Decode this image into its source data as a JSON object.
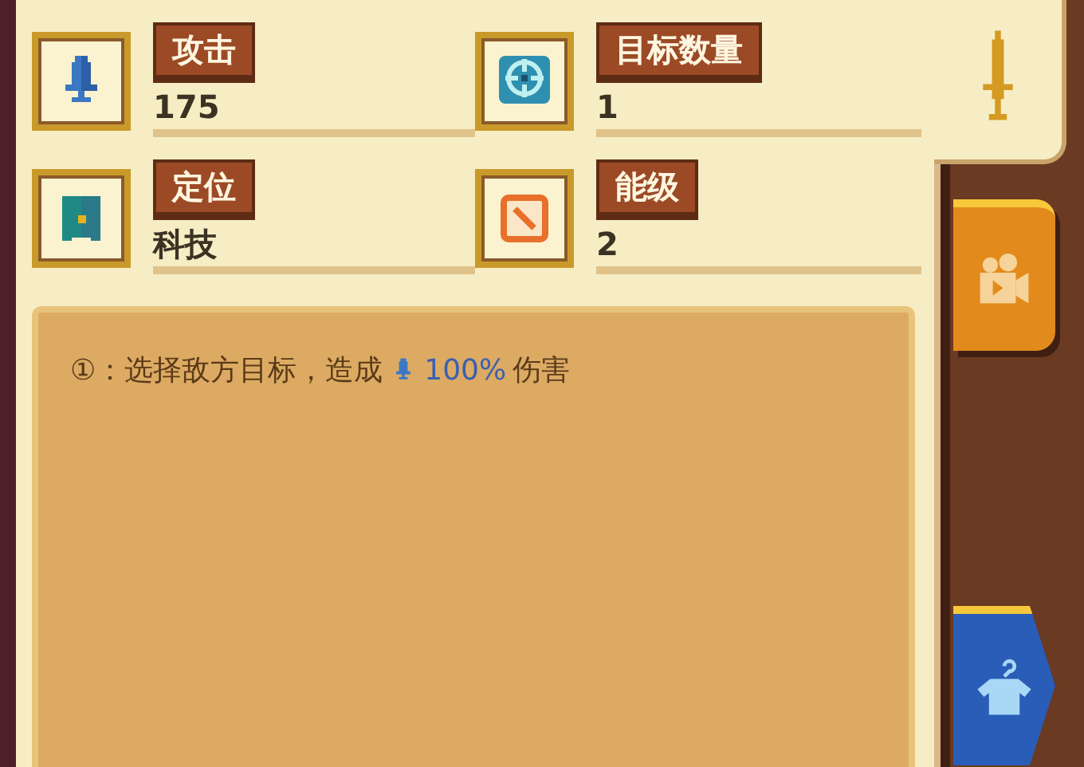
{
  "stats": [
    {
      "label": "攻击",
      "value": "175"
    },
    {
      "label": "目标数量",
      "value": "1"
    },
    {
      "label": "定位",
      "value": "科技"
    },
    {
      "label": "能级",
      "value": "2"
    }
  ],
  "description": {
    "prefix": "①：选择敌方目标，造成",
    "highlight": "100%",
    "suffix": "伤害"
  },
  "tabs": [
    {
      "selected": true,
      "color": "#f7edc4"
    },
    {
      "selected": false,
      "color": "#e38a1c"
    },
    {
      "selected": false,
      "color": "#2a5db8"
    }
  ]
}
